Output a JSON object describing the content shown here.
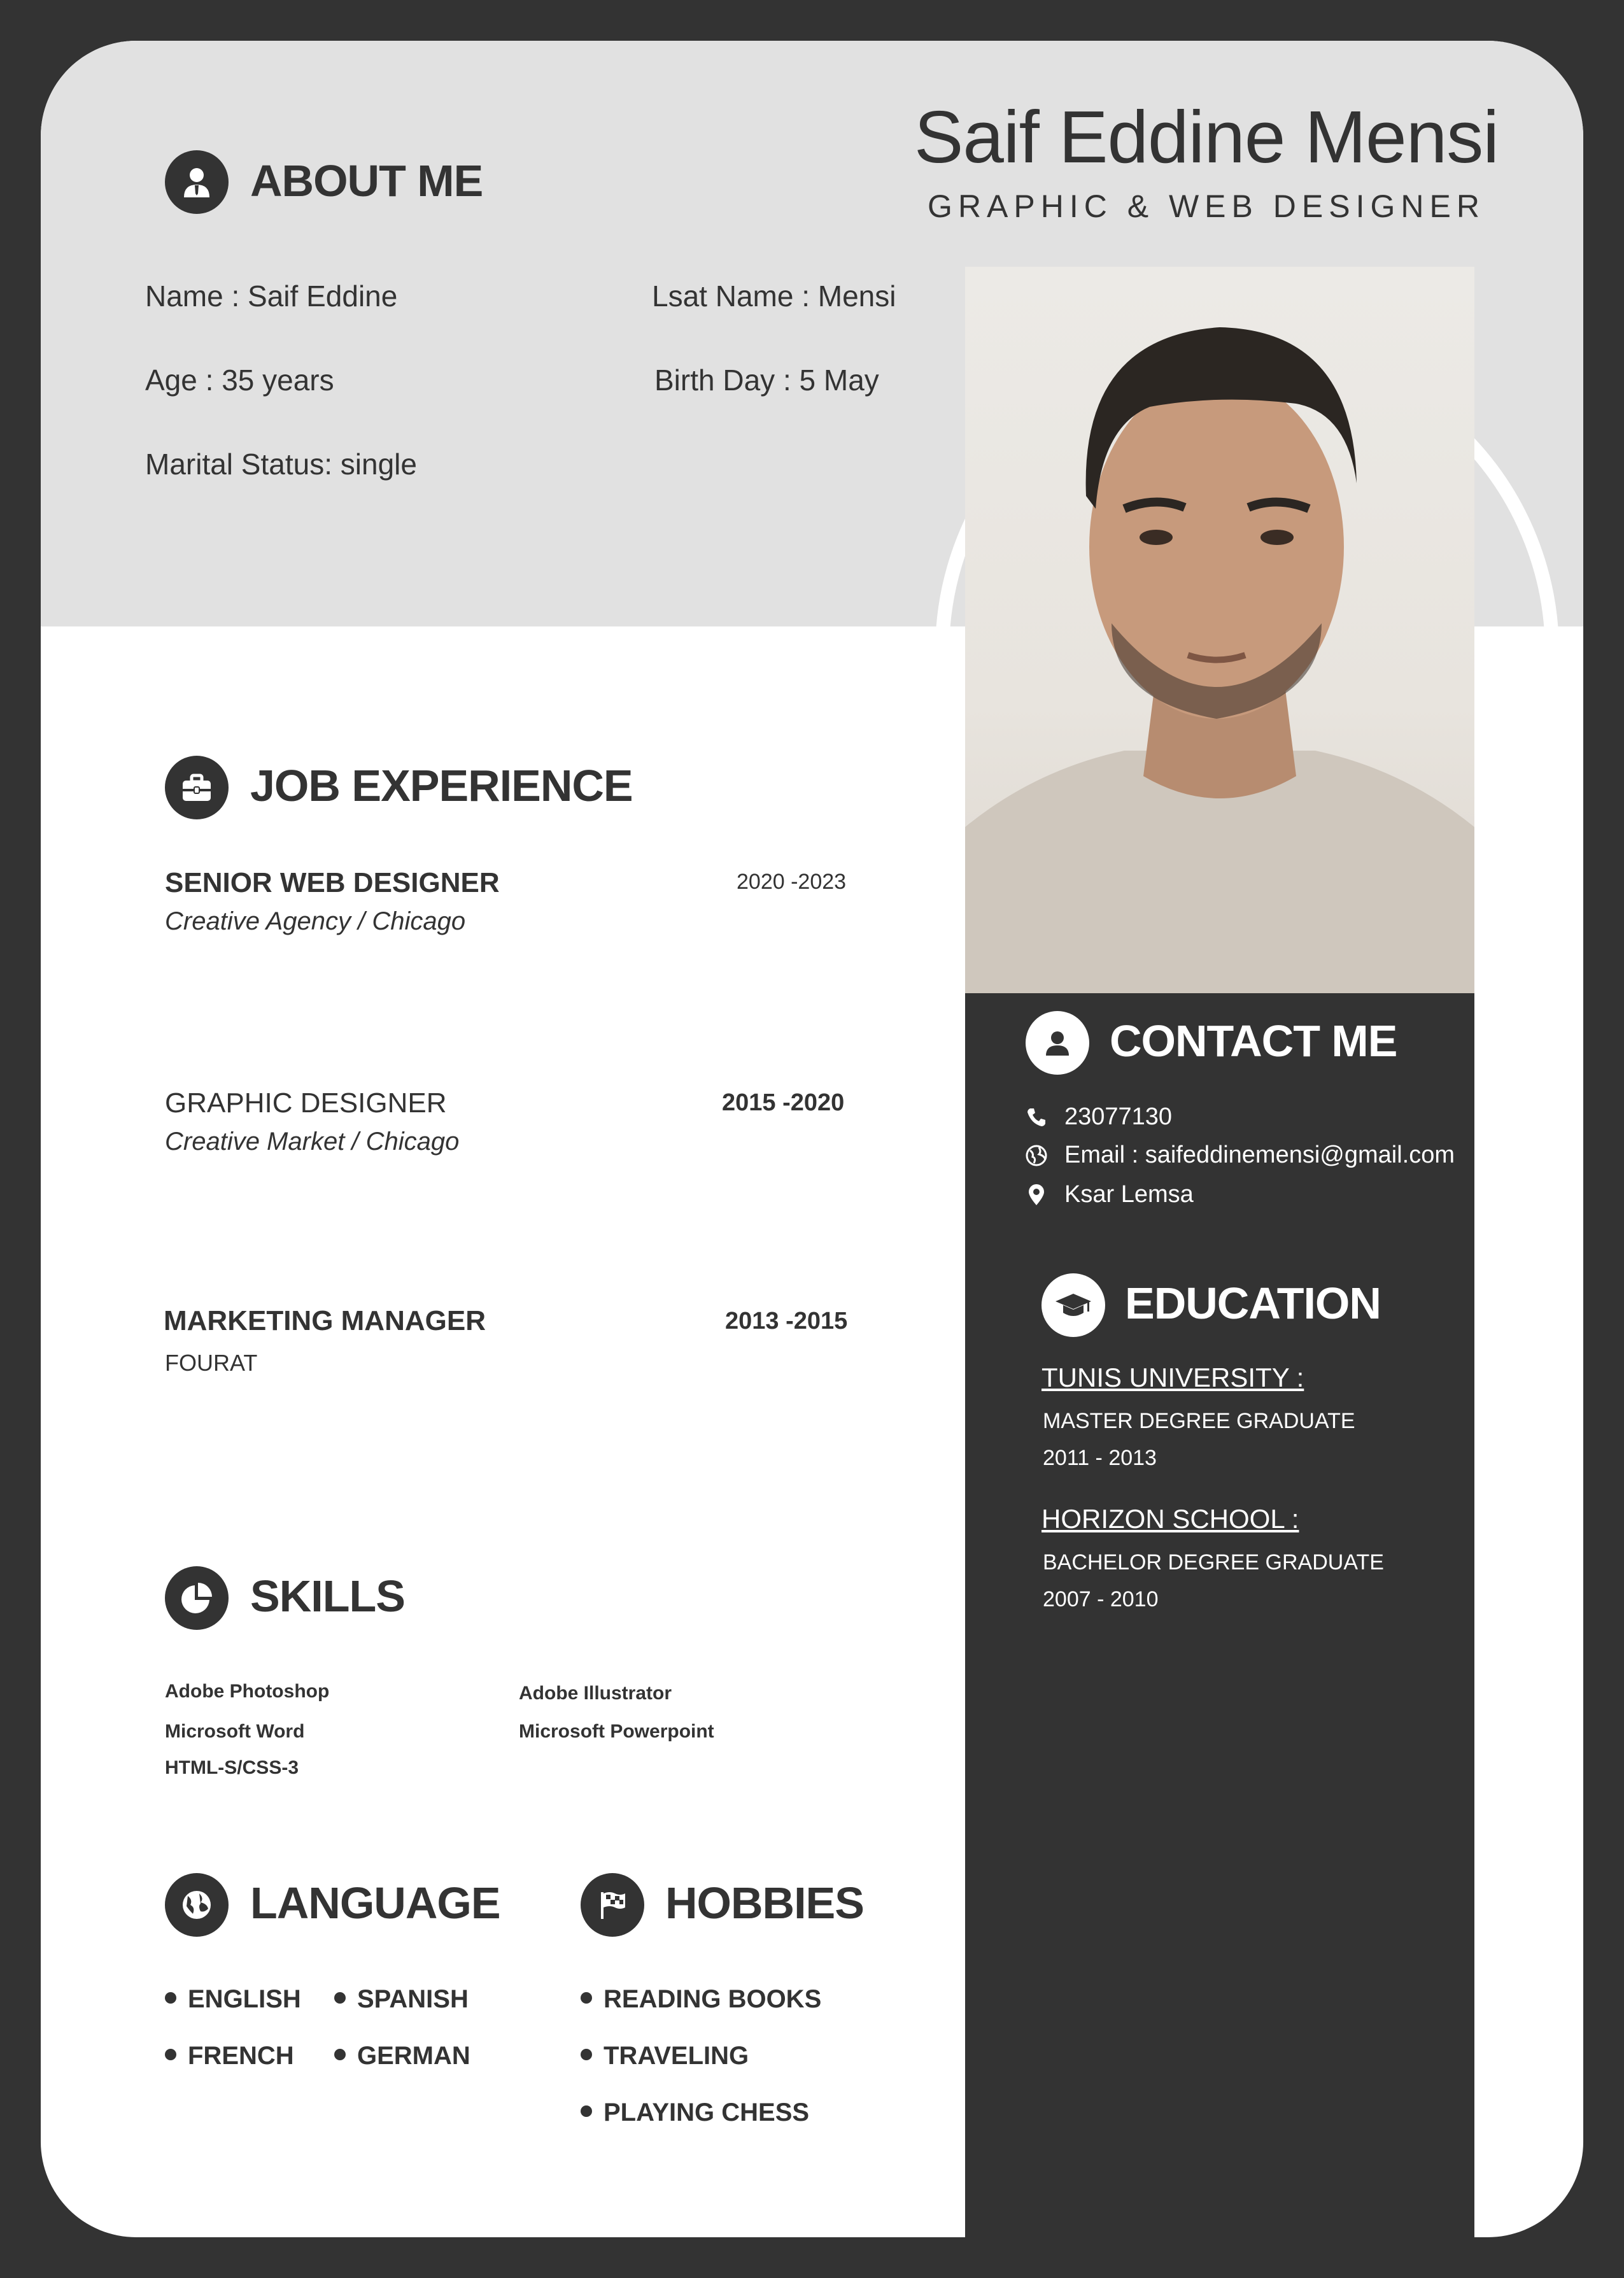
{
  "header": {
    "full_name": "Saif Eddine Mensi",
    "role": "GRAPHIC & WEB DESIGNER"
  },
  "about": {
    "title": "ABOUT ME",
    "name": "Name : Saif Eddine",
    "last_name": "Lsat Name : Mensi",
    "age": "Age : 35 years",
    "birthday": "Birth Day : 5 May",
    "marital": "Marital Status: single"
  },
  "experience": {
    "title": "JOB EXPERIENCE",
    "jobs": [
      {
        "title": "SENIOR WEB DESIGNER",
        "company": "Creative Agency / Chicago",
        "years": "2020 -2023"
      },
      {
        "title": "GRAPHIC DESIGNER",
        "company": "Creative Market / Chicago",
        "years": "2015 -2020"
      },
      {
        "title": "MARKETING MANAGER",
        "company": "FOURAT",
        "years": "2013 -2015"
      }
    ]
  },
  "skills": {
    "title": "SKILLS",
    "items": [
      "Adobe Photoshop",
      "Adobe Illustrator",
      "Microsoft Word",
      "Microsoft Powerpoint",
      "HTML-S/CSS-3"
    ]
  },
  "language": {
    "title": "LANGUAGE",
    "items": [
      "ENGLISH",
      "SPANISH",
      "FRENCH",
      "GERMAN"
    ]
  },
  "hobbies": {
    "title": "HOBBIES",
    "items": [
      "READING BOOKS",
      "TRAVELING",
      "PLAYING CHESS"
    ]
  },
  "contact": {
    "title": "CONTACT ME",
    "phone": "23077130",
    "email": "Email : saifeddinemensi@gmail.com",
    "location": "Ksar Lemsa"
  },
  "education": {
    "title": "EDUCATION",
    "entries": [
      {
        "school": "TUNIS UNIVERSITY :",
        "degree": "MASTER DEGREE GRADUATE",
        "years": "2011 - 2013"
      },
      {
        "school": "HORIZON SCHOOL :",
        "degree": "BACHELOR DEGREE GRADUATE",
        "years": "2007 - 2010"
      }
    ]
  },
  "colors": {
    "dark": "#333333",
    "light_band": "#e1e1e1",
    "white": "#ffffff"
  }
}
